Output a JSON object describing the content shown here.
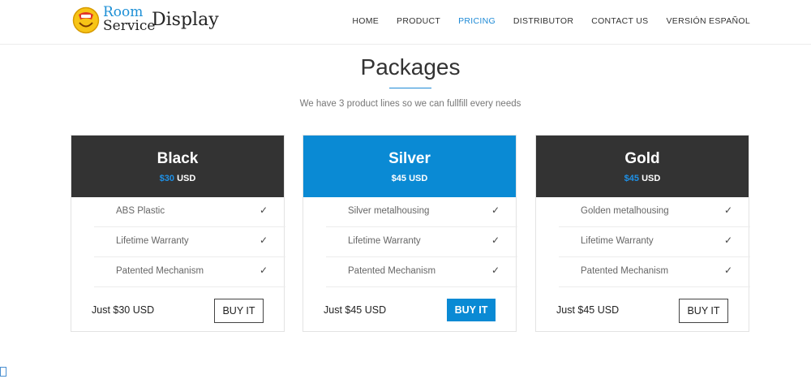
{
  "brand": {
    "room": "Room",
    "service": "Service",
    "display": "Display"
  },
  "nav": [
    {
      "label": "HOME",
      "active": false
    },
    {
      "label": "PRODUCT",
      "active": false
    },
    {
      "label": "PRICING",
      "active": true
    },
    {
      "label": "DISTRIBUTOR",
      "active": false
    },
    {
      "label": "CONTACT US",
      "active": false
    },
    {
      "label": "VERSIÓN ESPAÑOL",
      "active": false
    }
  ],
  "section": {
    "title": "Packages",
    "subtitle": "We have 3 product lines so we can fullfill every needs"
  },
  "plans": [
    {
      "name": "Black",
      "price_amount": "$30",
      "price_currency": "USD",
      "features": [
        "ABS Plastic",
        "Lifetime Warranty",
        "Patented Mechanism"
      ],
      "footer_price": "Just $30 USD",
      "button": "BUY IT"
    },
    {
      "name": "Silver",
      "price_amount": "$45",
      "price_currency": "USD",
      "features": [
        "Silver metalhousing",
        "Lifetime Warranty",
        "Patented Mechanism"
      ],
      "footer_price": "Just $45 USD",
      "button": "BUY IT"
    },
    {
      "name": "Gold",
      "price_amount": "$45",
      "price_currency": "USD",
      "features": [
        "Golden metalhousing",
        "Lifetime Warranty",
        "Patented Mechanism"
      ],
      "footer_price": "Just $45 USD",
      "button": "BUY IT"
    }
  ],
  "check_glyph": "✓",
  "colors": {
    "accent": "#0a8ad4",
    "dark_header": "#333333",
    "price_highlight": "#1e90e6"
  }
}
